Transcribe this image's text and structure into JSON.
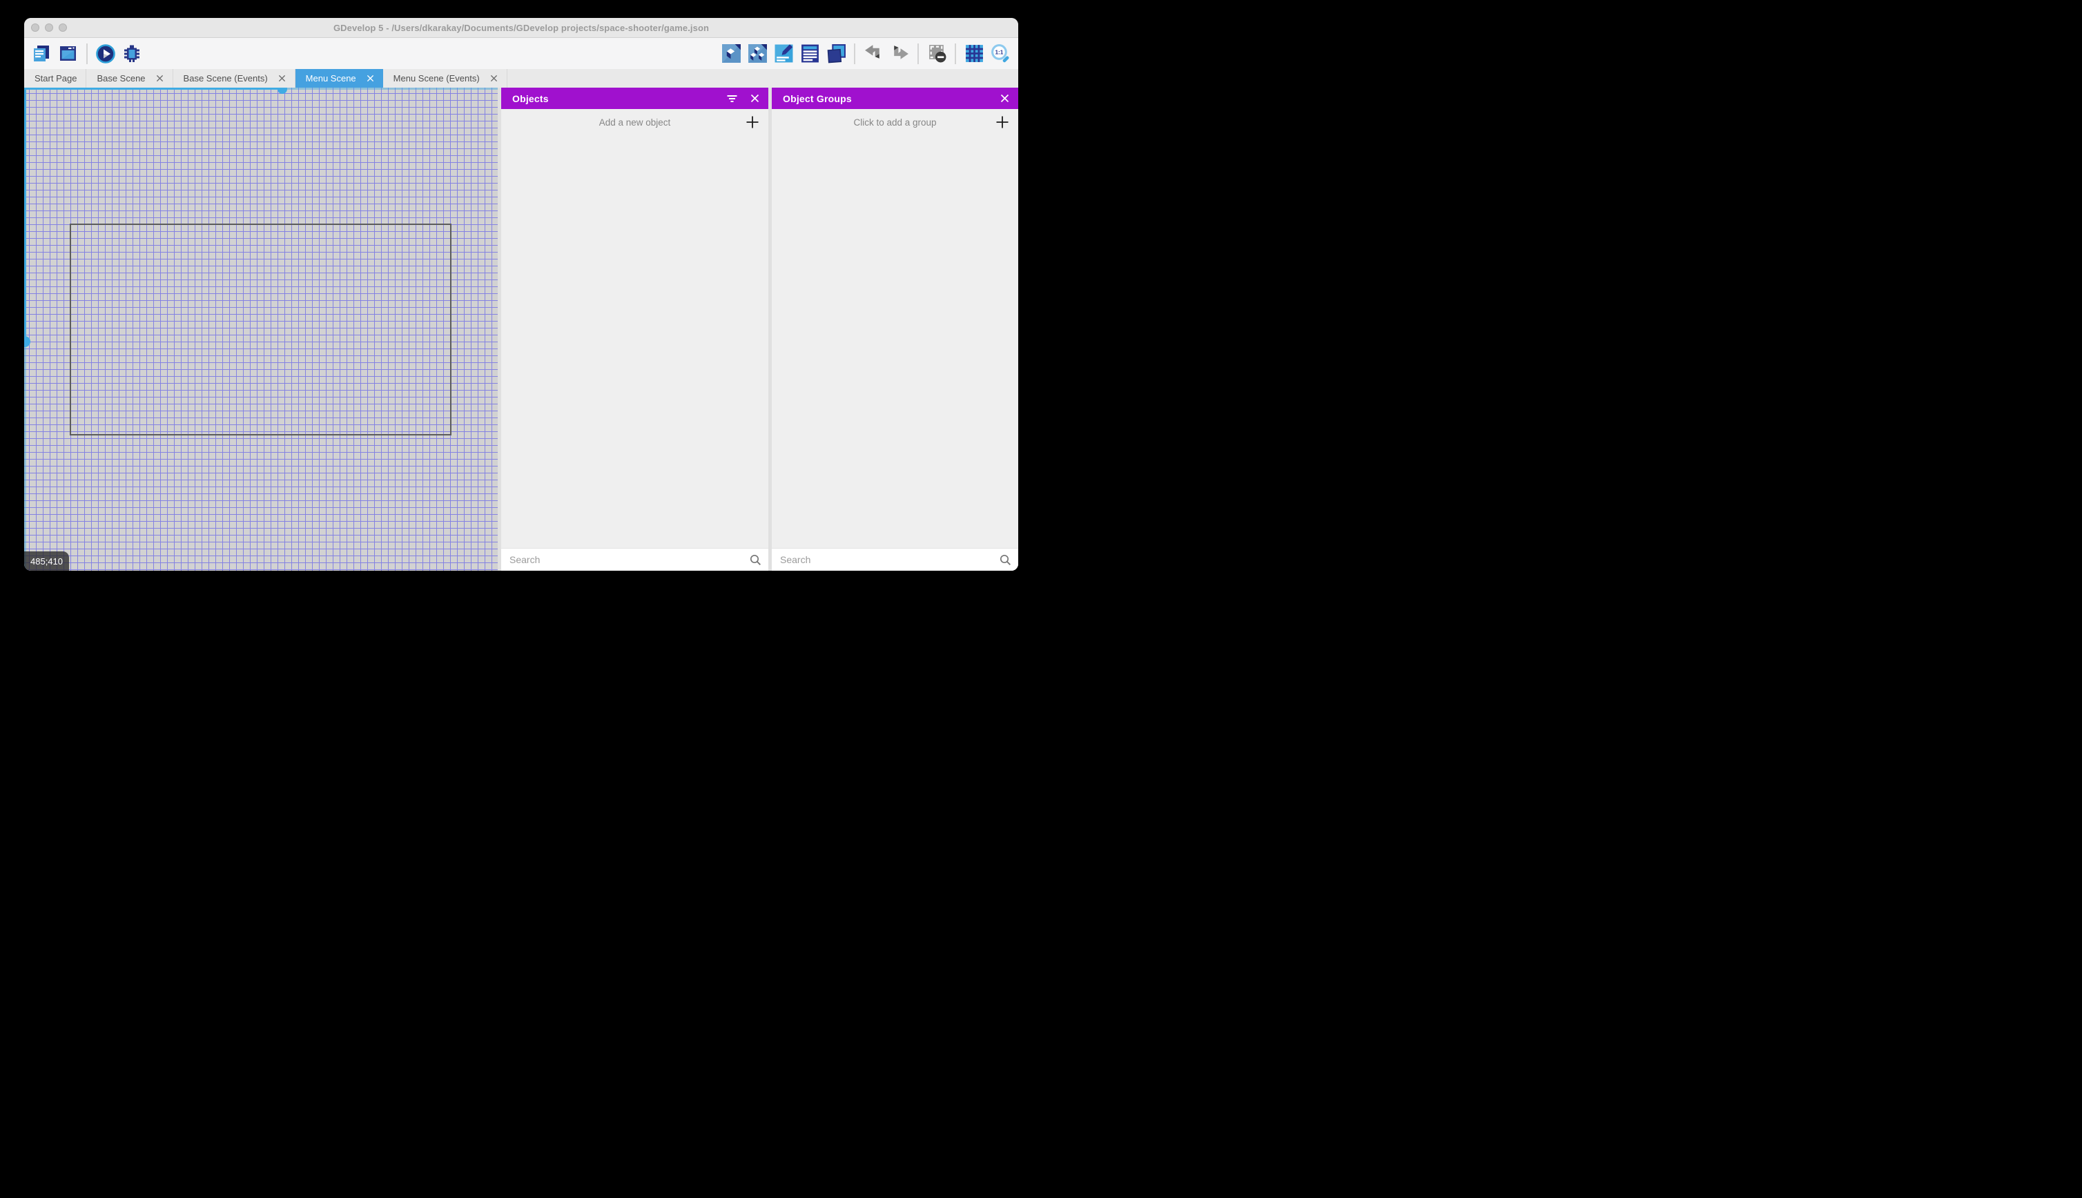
{
  "window": {
    "title": "GDevelop 5 - /Users/dkarakay/Documents/GDevelop projects/space-shooter/game.json"
  },
  "toolbar": {
    "left_icons": [
      "project-manager-icon",
      "window-icon",
      "play-icon",
      "bug-icon"
    ],
    "right_icons": [
      "objects-editor-icon",
      "object-groups-icon",
      "properties-icon",
      "instances-list-icon",
      "layers-icon",
      "undo-icon",
      "redo-icon",
      "window-mask-icon",
      "grid-icon",
      "zoom-1to1-icon"
    ],
    "zoom_label": "1:1"
  },
  "tabs": [
    {
      "label": "Start Page",
      "closable": false,
      "active": false
    },
    {
      "label": "Base Scene",
      "closable": true,
      "active": false
    },
    {
      "label": "Base Scene (Events)",
      "closable": true,
      "active": false
    },
    {
      "label": "Menu Scene",
      "closable": true,
      "active": true
    },
    {
      "label": "Menu Scene (Events)",
      "closable": true,
      "active": false
    }
  ],
  "canvas": {
    "coordinates": "485;410"
  },
  "panels": {
    "objects": {
      "title": "Objects",
      "add_label": "Add a new object",
      "search_placeholder": "Search",
      "search_value": ""
    },
    "object_groups": {
      "title": "Object Groups",
      "add_label": "Click to add a group",
      "search_placeholder": "Search",
      "search_value": ""
    }
  },
  "colors": {
    "panel_header": "#a011ce",
    "active_tab": "#45a1e0",
    "grid_line": "#8482e2",
    "canvas_bg": "#d2d2d2",
    "scrollbar": "#3fabe4"
  }
}
